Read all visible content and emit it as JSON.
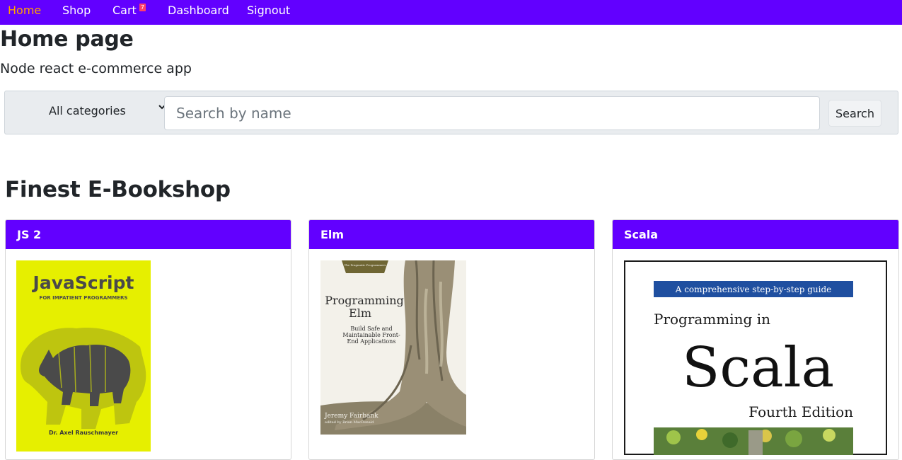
{
  "nav": {
    "home": "Home",
    "shop": "Shop",
    "cart": "Cart",
    "cart_count": "7",
    "dashboard": "Dashboard",
    "signout": "Signout"
  },
  "page": {
    "title": "Home page",
    "subtitle": "Node react e-commerce app"
  },
  "search": {
    "category_selected": "All categories",
    "placeholder": "Search by name",
    "button_label": "Search"
  },
  "section": {
    "title": "Finest E-Bookshop"
  },
  "products": [
    {
      "name": "JS 2",
      "cover": {
        "title": "JavaScript",
        "subtitle": "FOR IMPATIENT PROGRAMMERS",
        "author": "Dr. Axel Rauschmayer"
      }
    },
    {
      "name": "Elm",
      "cover": {
        "publisher": "The Pragmatic Programmers",
        "title_line1": "Programming",
        "title_line2": "Elm",
        "tagline": "Build Safe and Maintainable Front-End Applications",
        "author": "Jeremy Fairbank",
        "editor": "edited by Brian MacDonald"
      }
    },
    {
      "name": "Scala",
      "cover": {
        "banner": "A comprehensive step-by-step guide",
        "title_line1": "Programming in",
        "title_line2": "Scala",
        "edition": "Fourth Edition"
      }
    }
  ],
  "colors": {
    "brand": "#6200ff",
    "active_nav": "#ffa500",
    "badge": "#ff3f6a"
  }
}
